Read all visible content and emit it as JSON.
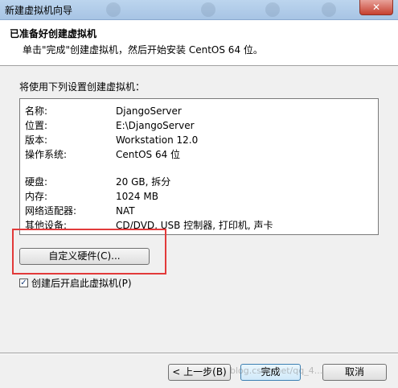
{
  "window": {
    "title": "新建虚拟机向导",
    "close_label": "✕"
  },
  "header": {
    "title": "已准备好创建虚拟机",
    "subtitle": "单击\"完成\"创建虚拟机，然后开始安装 CentOS 64 位。"
  },
  "intro_text": "将使用下列设置创建虚拟机：",
  "settings": [
    {
      "label": "名称:",
      "value": "DjangoServer"
    },
    {
      "label": "位置:",
      "value": "E:\\DjangoServer"
    },
    {
      "label": "版本:",
      "value": "Workstation 12.0"
    },
    {
      "label": "操作系统:",
      "value": "CentOS 64 位"
    },
    {
      "label": "硬盘:",
      "value": "20 GB, 拆分"
    },
    {
      "label": "内存:",
      "value": "1024 MB"
    },
    {
      "label": "网络适配器:",
      "value": "NAT"
    },
    {
      "label": "其他设备:",
      "value": "CD/DVD, USB 控制器, 打印机, 声卡"
    }
  ],
  "customize_button": "自定义硬件(C)...",
  "power_on": {
    "label": "创建后开启此虚拟机(P)",
    "checked": true
  },
  "buttons": {
    "back": "< 上一步(B)",
    "finish": "完成",
    "cancel": "取消"
  },
  "watermark": "blog.csdn.net/qq_4..."
}
